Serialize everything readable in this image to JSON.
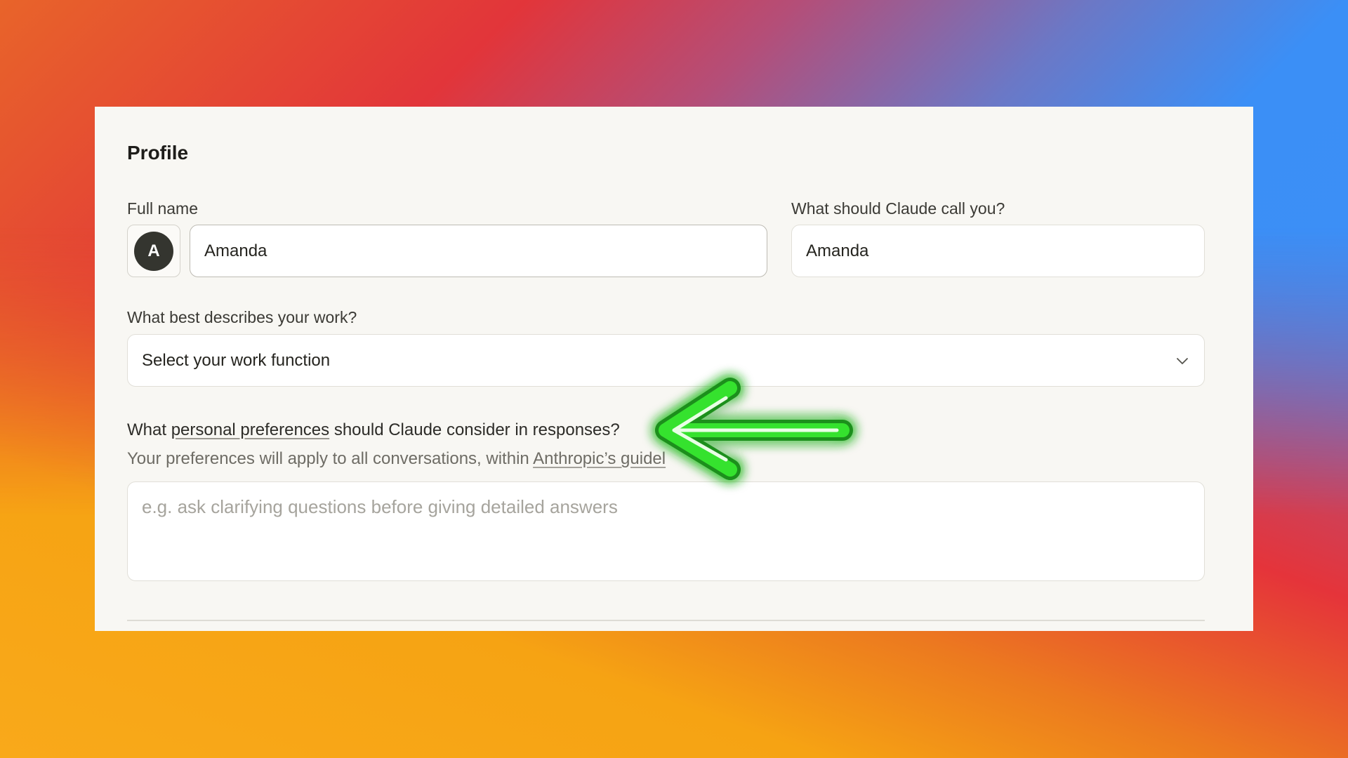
{
  "profile": {
    "title": "Profile",
    "full_name": {
      "label": "Full name",
      "avatar_initial": "A",
      "value": "Amanda"
    },
    "call_you": {
      "label": "What should Claude call you?",
      "value": "Amanda"
    },
    "work_function": {
      "label": "What best describes your work?",
      "selected": "Select your work function",
      "icon": "chevron-down-icon"
    },
    "preferences": {
      "question_prefix": "What ",
      "question_link": "personal preferences",
      "question_suffix": " should Claude consider in responses?",
      "helper_prefix": "Your preferences will apply to all conversations, within ",
      "helper_link": "Anthropic’s guidel",
      "placeholder": "e.g. ask clarifying questions before giving detailed answers"
    }
  },
  "annotation": {
    "icon": "arrow-left-icon",
    "color": "#2ee62a"
  },
  "colors": {
    "card_background": "#f8f7f3",
    "avatar_background": "#34352f"
  }
}
